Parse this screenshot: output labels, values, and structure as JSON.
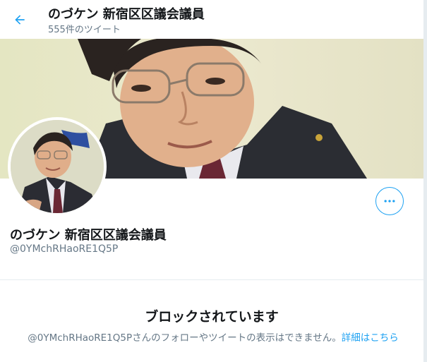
{
  "header": {
    "back_icon": "arrow-left-icon",
    "title": "のづケン 新宿区区議会議員",
    "tweet_count": "555件のツイート"
  },
  "banner": {
    "description": "profile-banner-photo"
  },
  "profile": {
    "name": "のづケン 新宿区区議会議員",
    "handle": "@0YMchRHaoRE1Q5P",
    "more_icon": "more-horizontal-icon"
  },
  "blocked": {
    "title": "ブロックされています",
    "message": "@0YMchRHaoRE1Q5Pさんのフォローやツイートの表示はできません。",
    "link": "詳細はこちら"
  },
  "colors": {
    "accent": "#1da1f2",
    "text": "#14171a",
    "muted": "#657786",
    "border": "#e6ecf0"
  }
}
